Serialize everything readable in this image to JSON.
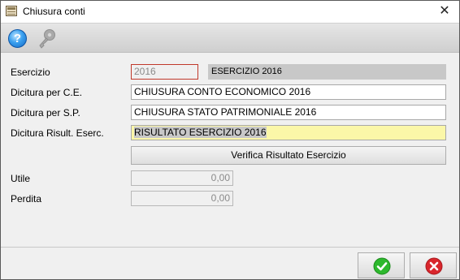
{
  "window": {
    "title": "Chiusura conti",
    "close_glyph": "✕",
    "icon": "window-icon"
  },
  "toolbar": {
    "help_glyph": "?",
    "help_icon": "help-icon",
    "key_icon": "key-icon"
  },
  "form": {
    "esercizio": {
      "label": "Esercizio",
      "year": "2016",
      "description": "ESERCIZIO 2016"
    },
    "dicitura_ce": {
      "label": "Dicitura  per C.E.",
      "value": "CHIUSURA CONTO ECONOMICO 2016"
    },
    "dicitura_sp": {
      "label": "Dicitura per S.P.",
      "value": "CHIUSURA STATO PATRIMONIALE 2016"
    },
    "dicitura_risult": {
      "label": "Dicitura Risult. Eserc.",
      "value": "RISULTATO ESERCIZIO 2016"
    },
    "verify_button": "Verifica Risultato Esercizio",
    "utile": {
      "label": "Utile",
      "value": "0,00"
    },
    "perdita": {
      "label": "Perdita",
      "value": "0,00"
    }
  },
  "actions": {
    "ok_icon": "confirm-check-icon",
    "cancel_icon": "cancel-x-icon"
  },
  "colors": {
    "highlight_yellow": "#fbf7a8",
    "invalid_border": "#c0392b",
    "ok_green": "#2db82d",
    "cancel_red": "#d9262c"
  }
}
